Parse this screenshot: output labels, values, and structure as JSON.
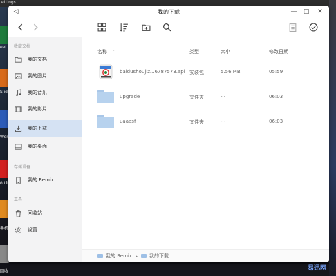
{
  "desktop": {
    "corner_text": "ettings",
    "apps": [
      {
        "label": "eet",
        "color": "#1e7c3c"
      },
      {
        "label": "Slide",
        "color": "#d86a1a"
      },
      {
        "label": "Wor",
        "color": "#2b5bb8"
      },
      {
        "label": "ouTu",
        "color": "#d32020"
      },
      {
        "label": "手机",
        "color": "#e08a20"
      },
      {
        "label": "回收",
        "color": "#888888"
      }
    ],
    "watermark": "易迅网"
  },
  "window": {
    "title": "我的下载",
    "controls": {
      "back": "◁",
      "minimize": "—",
      "maximize": "□",
      "close": "✕"
    },
    "toolbar": {
      "back_icon": "chevron-left",
      "forward_icon": "chevron-right",
      "grid_icon": "grid",
      "sort_icon": "sort",
      "new_folder_icon": "folder-plus",
      "search_icon": "search",
      "clipboard_icon": "clipboard",
      "select_icon": "check-circle"
    }
  },
  "sidebar": {
    "section_favorites": "收藏文档",
    "items": [
      {
        "label": "我的文档",
        "icon": "folder"
      },
      {
        "label": "我的图片",
        "icon": "image"
      },
      {
        "label": "我的音乐",
        "icon": "music"
      },
      {
        "label": "我的影片",
        "icon": "film"
      },
      {
        "label": "我的下载",
        "icon": "download",
        "active": true
      },
      {
        "label": "我的桌面",
        "icon": "desktop"
      }
    ],
    "section_devices": "存储设备",
    "device_items": [
      {
        "label": "我的 Remix",
        "icon": "phone"
      }
    ],
    "section_tools": "工具",
    "tool_items": [
      {
        "label": "回收站",
        "icon": "trash"
      },
      {
        "label": "设置",
        "icon": "gear"
      }
    ]
  },
  "columns": {
    "name": "名称",
    "sort_arrow": "˅",
    "type": "类型",
    "size": "大小",
    "modified": "修改日期"
  },
  "files": [
    {
      "name": "baidushoujiz...6787573.apk",
      "type": "安装包",
      "size": "5.56 MB",
      "modified": "05:59",
      "kind": "apk"
    },
    {
      "name": "upgrade",
      "type": "文件夹",
      "size": "- -",
      "modified": "06:03",
      "kind": "folder"
    },
    {
      "name": "uaaasf",
      "type": "文件夹",
      "size": "- -",
      "modified": "06:03",
      "kind": "folder"
    }
  ],
  "breadcrumb": [
    {
      "label": "我的 Remix"
    },
    {
      "label": "我的下载"
    }
  ],
  "breadcrumb_sep": "▸"
}
